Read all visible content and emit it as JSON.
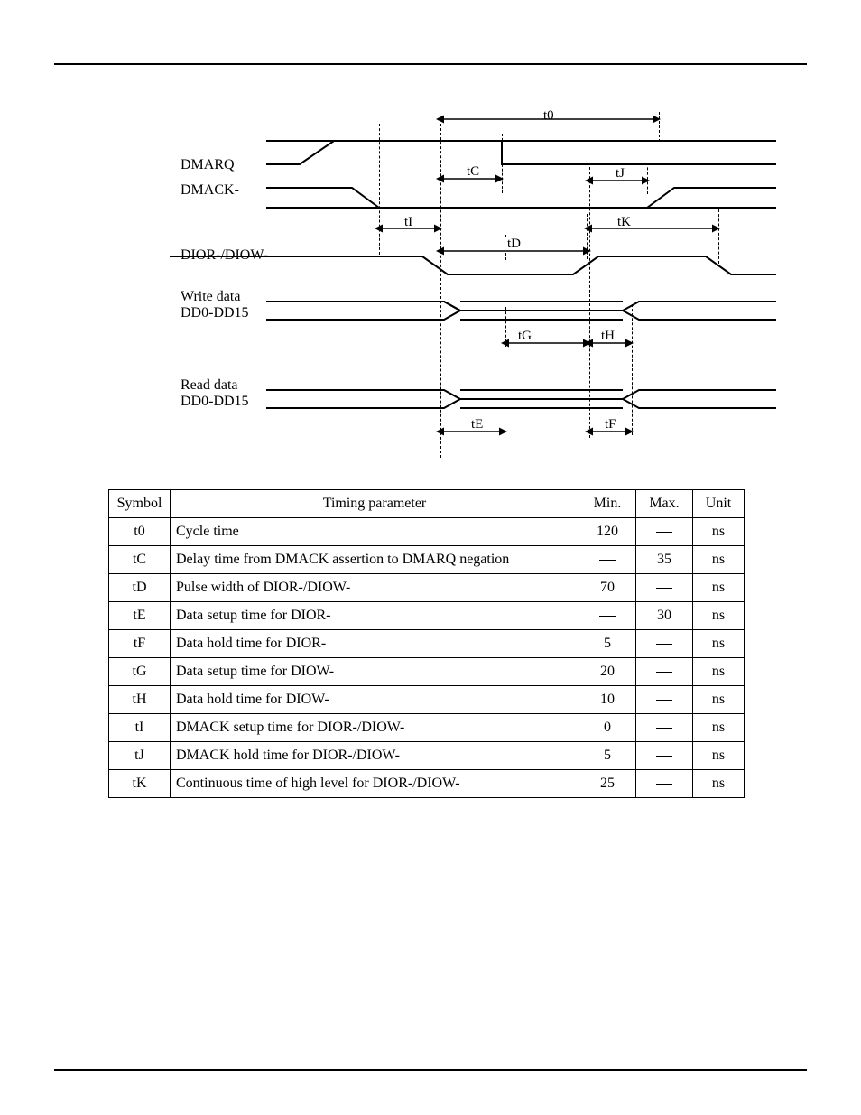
{
  "diagram": {
    "signals": [
      {
        "name": "DMARQ",
        "label": "DMARQ"
      },
      {
        "name": "DMACK-",
        "label": "DMACK-"
      },
      {
        "name": "DIORDIOW",
        "label": "DIOR-/DIOW-"
      },
      {
        "name": "WriteData",
        "label": "Write data\nDD0-DD15"
      },
      {
        "name": "ReadData",
        "label": "Read data\nDD0-DD15"
      }
    ],
    "dims": {
      "t0": "t0",
      "tC": "tC",
      "tJ": "tJ",
      "tI": "tI",
      "tD": "tD",
      "tK": "tK",
      "tG": "tG",
      "tH": "tH",
      "tE": "tE",
      "tF": "tF"
    }
  },
  "table": {
    "headers": {
      "symbol": "Symbol",
      "param": "Timing parameter",
      "min": "Min.",
      "max": "Max.",
      "unit": "Unit"
    },
    "rows": [
      {
        "sym": "t0",
        "param": "Cycle time",
        "min": "120",
        "max": "—",
        "unit": "ns"
      },
      {
        "sym": "tC",
        "param": "Delay time from DMACK assertion to DMARQ negation",
        "min": "—",
        "max": "35",
        "unit": "ns"
      },
      {
        "sym": "tD",
        "param": "Pulse width of DIOR-/DIOW-",
        "min": "70",
        "max": "—",
        "unit": "ns"
      },
      {
        "sym": "tE",
        "param": "Data setup time for DIOR-",
        "min": "—",
        "max": "30",
        "unit": "ns"
      },
      {
        "sym": "tF",
        "param": "Data hold time for DIOR-",
        "min": "5",
        "max": "—",
        "unit": "ns"
      },
      {
        "sym": "tG",
        "param": "Data setup time for DIOW-",
        "min": "20",
        "max": "—",
        "unit": "ns"
      },
      {
        "sym": "tH",
        "param": "Data hold time for DIOW-",
        "min": "10",
        "max": "—",
        "unit": "ns"
      },
      {
        "sym": "tI",
        "param": "DMACK setup time for DIOR-/DIOW-",
        "min": "0",
        "max": "—",
        "unit": "ns"
      },
      {
        "sym": "tJ",
        "param": "DMACK hold time for DIOR-/DIOW-",
        "min": "5",
        "max": "—",
        "unit": "ns"
      },
      {
        "sym": "tK",
        "param": "Continuous time of high level for DIOR-/DIOW-",
        "min": "25",
        "max": "—",
        "unit": "ns"
      }
    ]
  }
}
